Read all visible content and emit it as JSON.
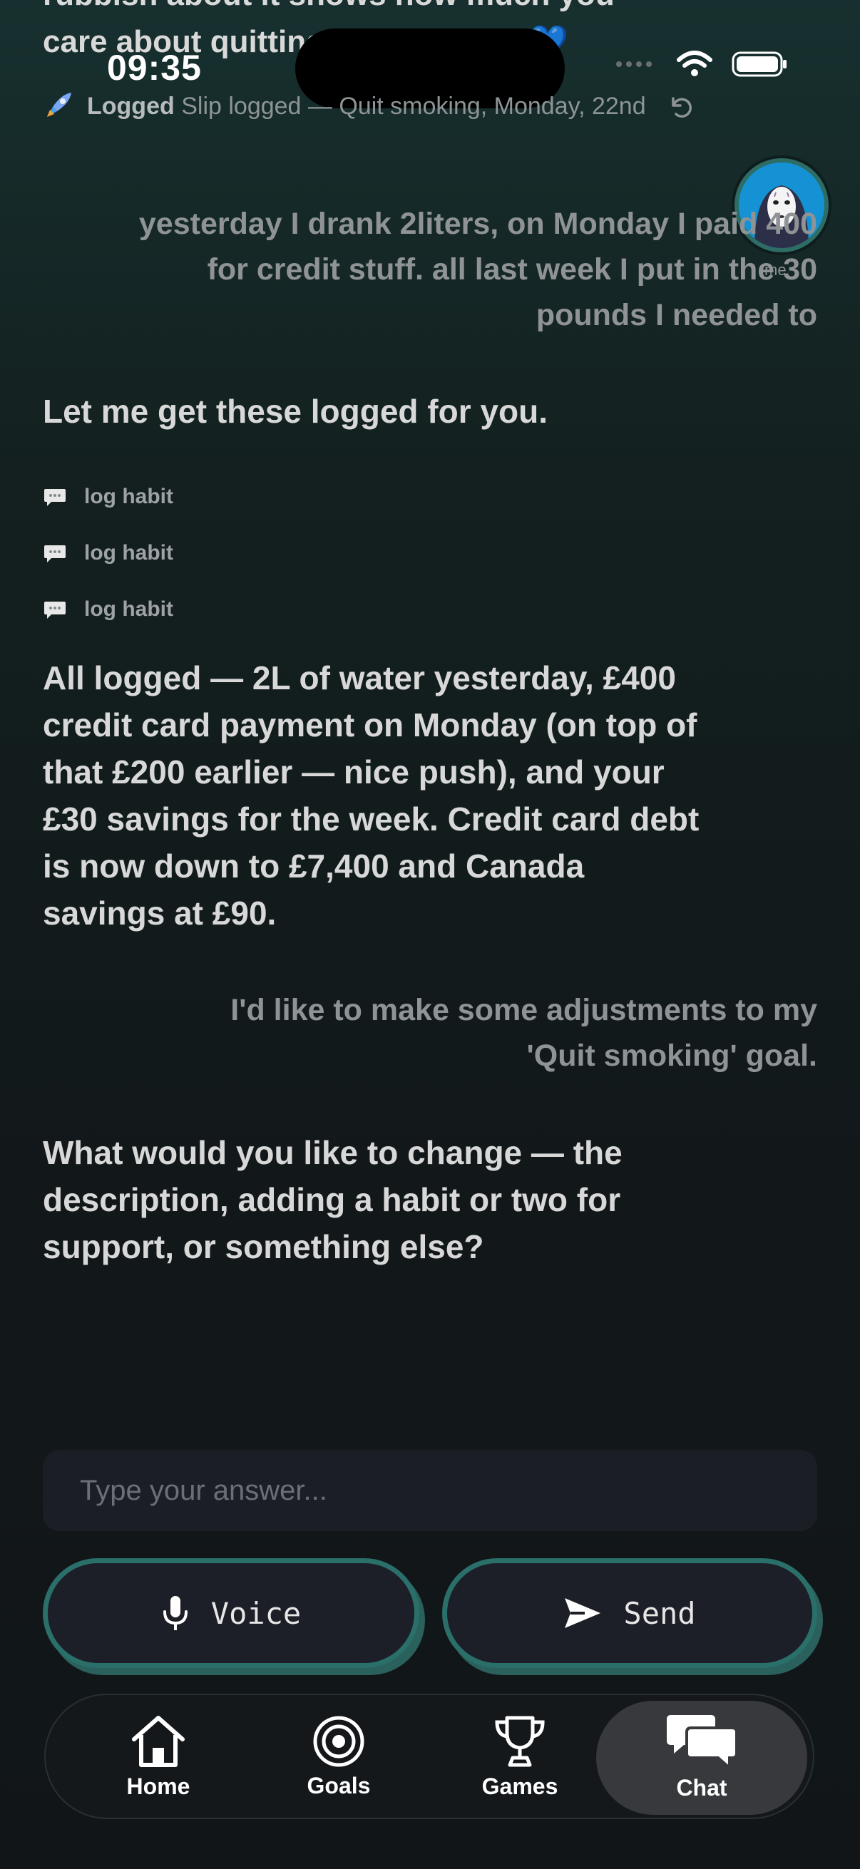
{
  "status_bar": {
    "time": "09:35"
  },
  "top_partial_message": {
    "line1": "rubbish about it shows how much you",
    "line2": "care about quitting and matters. 💙"
  },
  "logged_banner": {
    "badge": "Logged",
    "text": "Slip logged — Quit smoking, Monday, 22nd"
  },
  "avatar_label": "me",
  "messages": {
    "user_1": "yesterday I drank 2liters, on Monday I paid 400 for credit stuff. all last week I put in the 30 pounds I needed to",
    "ai_1": "Let me get these logged for you.",
    "tool_calls": [
      "log habit",
      "log habit",
      "log habit"
    ],
    "ai_2": "All logged — 2L of water yesterday, £400 credit card payment on Monday (on top of that £200 earlier — nice push), and your £30 savings for the week. Credit card debt is now down to £7,400 and Canada savings at £90.",
    "user_2": "I'd like to make some adjustments to my 'Quit smoking' goal.",
    "ai_3": "What would you like to change — the description, adding a habit or two for support, or something else?"
  },
  "composer": {
    "placeholder": "Type your answer...",
    "voice_label": "Voice",
    "send_label": "Send"
  },
  "nav": {
    "items": [
      {
        "label": "Home",
        "icon": "home-icon"
      },
      {
        "label": "Goals",
        "icon": "target-icon"
      },
      {
        "label": "Games",
        "icon": "trophy-icon"
      },
      {
        "label": "Chat",
        "icon": "chat-bubbles-icon"
      }
    ],
    "active": "Chat"
  },
  "colors": {
    "accent_teal": "#2a6f69",
    "nav_active_bg": "#37393c",
    "input_bg": "#1c1e25"
  }
}
